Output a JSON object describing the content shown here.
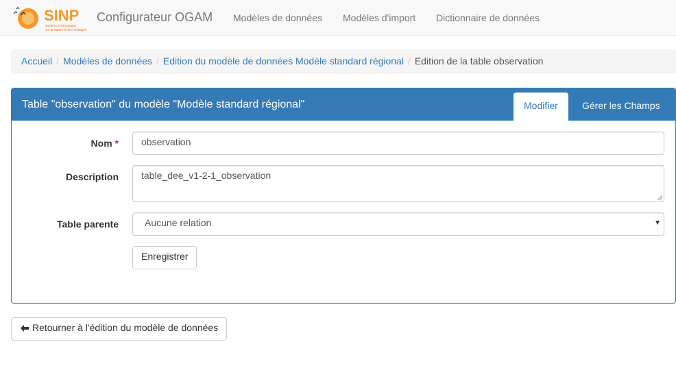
{
  "navbar": {
    "logo_text": "SINP",
    "logo_subtitle": "Système d'information sur la Nature et les Paysages",
    "brand": "Configurateur OGAM",
    "links": [
      {
        "label": "Modèles de données"
      },
      {
        "label": "Modèles d'import"
      },
      {
        "label": "Dictionnaire de données"
      }
    ]
  },
  "breadcrumb": {
    "items": [
      {
        "label": "Accueil"
      },
      {
        "label": "Modèles de données"
      },
      {
        "label": "Edition du modèle de données Modèle standard régional"
      }
    ],
    "active": "Edition de la table observation",
    "separator": "/"
  },
  "panel": {
    "title": "Table \"observation\" du modèle \"Modèle standard régional\"",
    "tabs": [
      {
        "label": "Modifier",
        "active": true
      },
      {
        "label": "Gérer les Champs",
        "active": false
      }
    ]
  },
  "form": {
    "nom_label": "Nom",
    "required_mark": "*",
    "nom_value": "observation",
    "description_label": "Description",
    "description_value": "table_dee_v1-2-1_observation",
    "parent_label": "Table parente",
    "parent_value": "Aucune relation",
    "submit_label": "Enregistrer"
  },
  "back_button": {
    "label": "Retourner à l'édition du modèle de données",
    "icon": "arrow-left-icon"
  },
  "colors": {
    "primary": "#337ab7",
    "logo_orange": "#f39a2b",
    "required": "#a94442"
  }
}
